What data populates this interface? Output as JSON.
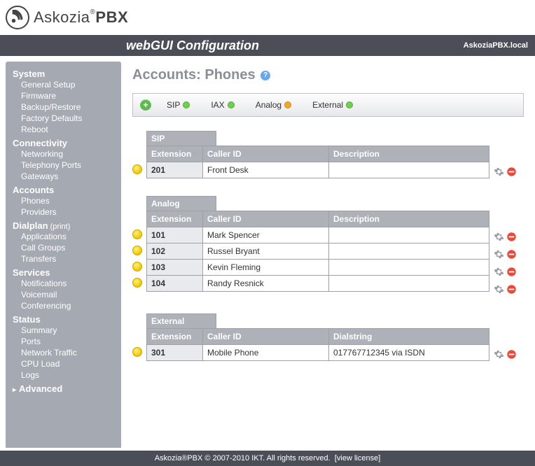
{
  "logo": {
    "brand": "Askozia",
    "suffix": "PBX",
    "reg": "®"
  },
  "title_strip": {
    "title": "webGUI Configuration",
    "hostname": "AskoziaPBX.local"
  },
  "page_title_prefix": "Accounts:",
  "page_title_main": "Phones",
  "sidebar": [
    {
      "type": "group",
      "label": "System"
    },
    {
      "type": "item",
      "label": "General Setup"
    },
    {
      "type": "item",
      "label": "Firmware"
    },
    {
      "type": "item",
      "label": "Backup/Restore"
    },
    {
      "type": "item",
      "label": "Factory Defaults"
    },
    {
      "type": "item",
      "label": "Reboot"
    },
    {
      "type": "group",
      "label": "Connectivity"
    },
    {
      "type": "item",
      "label": "Networking"
    },
    {
      "type": "item",
      "label": "Telephony Ports"
    },
    {
      "type": "item",
      "label": "Gateways"
    },
    {
      "type": "group",
      "label": "Accounts"
    },
    {
      "type": "item",
      "label": "Phones"
    },
    {
      "type": "item",
      "label": "Providers"
    },
    {
      "type": "group",
      "label": "Dialplan",
      "inline": "(print)"
    },
    {
      "type": "item",
      "label": "Applications"
    },
    {
      "type": "item",
      "label": "Call Groups"
    },
    {
      "type": "item",
      "label": "Transfers"
    },
    {
      "type": "group",
      "label": "Services"
    },
    {
      "type": "item",
      "label": "Notifications"
    },
    {
      "type": "item",
      "label": "Voicemail"
    },
    {
      "type": "item",
      "label": "Conferencing"
    },
    {
      "type": "group",
      "label": "Status"
    },
    {
      "type": "item",
      "label": "Summary"
    },
    {
      "type": "item",
      "label": "Ports"
    },
    {
      "type": "item",
      "label": "Network Traffic"
    },
    {
      "type": "item",
      "label": "CPU Load"
    },
    {
      "type": "item",
      "label": "Logs"
    },
    {
      "type": "advanced",
      "label": "Advanced"
    }
  ],
  "add_types": [
    {
      "label": "SIP",
      "dot": "green"
    },
    {
      "label": "IAX",
      "dot": "green"
    },
    {
      "label": "Analog",
      "dot": "orange"
    },
    {
      "label": "External",
      "dot": "green"
    }
  ],
  "sections": [
    {
      "title": "SIP",
      "third_col": "Description",
      "cols": {
        "ext": "Extension",
        "cid": "Caller ID"
      },
      "rows": [
        {
          "ext": "201",
          "cid": "Front Desk",
          "c3": ""
        }
      ]
    },
    {
      "title": "Analog",
      "third_col": "Description",
      "cols": {
        "ext": "Extension",
        "cid": "Caller ID"
      },
      "rows": [
        {
          "ext": "101",
          "cid": "Mark Spencer",
          "c3": ""
        },
        {
          "ext": "102",
          "cid": "Russel Bryant",
          "c3": ""
        },
        {
          "ext": "103",
          "cid": "Kevin Fleming",
          "c3": ""
        },
        {
          "ext": "104",
          "cid": "Randy Resnick",
          "c3": ""
        }
      ]
    },
    {
      "title": "External",
      "third_col": "Dialstring",
      "cols": {
        "ext": "Extension",
        "cid": "Caller ID"
      },
      "rows": [
        {
          "ext": "301",
          "cid": "Mobile Phone",
          "c3": "017767712345 via ISDN"
        }
      ]
    }
  ],
  "footer": {
    "text": "Askozia®PBX © 2007-2010 IKT. All rights reserved.",
    "link": "[view license]"
  }
}
